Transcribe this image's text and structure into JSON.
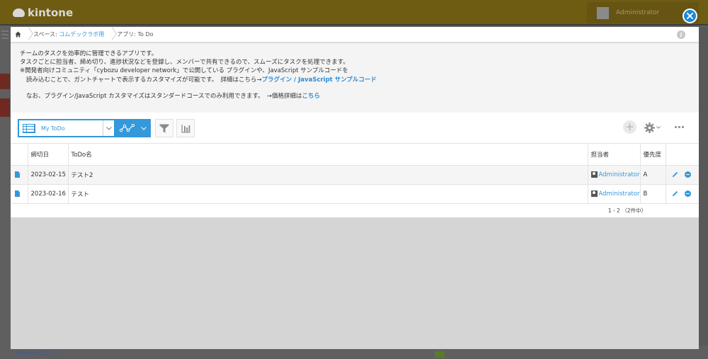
{
  "background": {
    "logo_text": "kintone",
    "user_name": "Administrator",
    "footer_link": "kViewerログイン"
  },
  "breadcrumb": {
    "space_prefix": "スペース: ",
    "space_name": "コムデックラボ用",
    "app_label": "アプリ: To Do"
  },
  "description": {
    "line1": "チームのタスクを効率的に管理できるアプリです。",
    "line2": "タスクごとに担当者、締め切り、進捗状況などを登録し、メンバーで共有できるので、スムーズにタスクを処理できます。",
    "line3": "※開発者向けコミュニティ「cybozu developer network」で公開している プラグインや、JavaScript サンプルコードを",
    "line4_text": "読み込むことで、ガントチャートで表示するカスタマイズが可能です。　詳細はこちら→",
    "link_plugin": "プラグイン",
    "link_sep": " / ",
    "link_js": "JavaScript サンプルコード",
    "line5_text": "なお、プラグイン/JavaScript カスタマイズはスタンダードコースでのみ利用できます。　→価格詳細は",
    "link_price": "こちら"
  },
  "toolbar": {
    "view_name": "My ToDo",
    "add_symbol": "+"
  },
  "table": {
    "headers": [
      "締切日",
      "ToDo名",
      "担当者",
      "優先度"
    ],
    "rows": [
      {
        "deadline": "2023-02-15",
        "name": "テスト2",
        "assignee": "Administrator",
        "priority": "A"
      },
      {
        "deadline": "2023-02-16",
        "name": "テスト",
        "assignee": "Administrator",
        "priority": "B"
      }
    ],
    "pager": "1 - 2 （2件中）"
  },
  "colors": {
    "accent": "#3498db",
    "close_button": "#1e88d4"
  },
  "icons": [
    "home-icon",
    "info-icon",
    "close-icon",
    "table-view-icon",
    "graph-icon",
    "filter-icon",
    "chart-icon",
    "plus-icon",
    "gear-icon",
    "more-icon",
    "record-icon",
    "user-icon",
    "edit-icon",
    "delete-icon"
  ]
}
